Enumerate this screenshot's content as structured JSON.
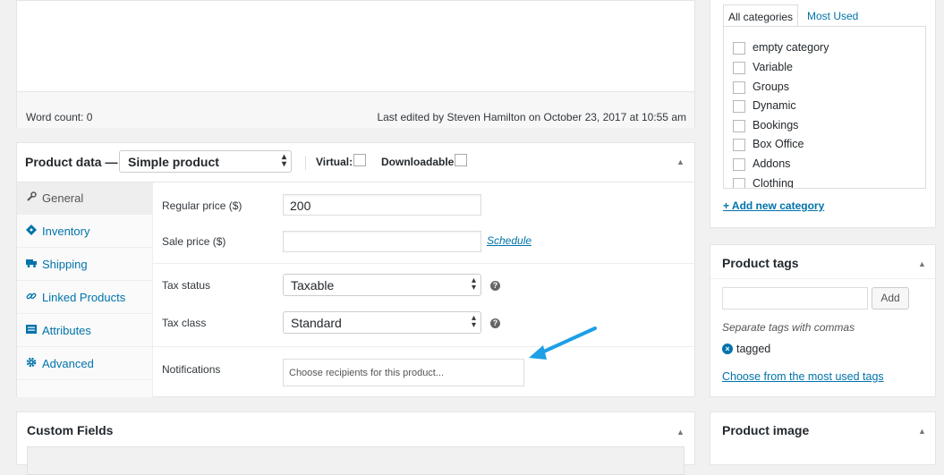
{
  "editor": {
    "word_count": "Word count: 0",
    "last_edited": "Last edited by Steven Hamilton on October 23, 2017 at 10:55 am"
  },
  "product_data": {
    "title": "Product data —",
    "type_select": "Simple product",
    "virtual_label": "Virtual:",
    "downloadable_label": "Downloadable:",
    "tabs": [
      {
        "label": "General",
        "icon": "wrench-icon"
      },
      {
        "label": "Inventory",
        "icon": "tag-icon"
      },
      {
        "label": "Shipping",
        "icon": "truck-icon"
      },
      {
        "label": "Linked Products",
        "icon": "link-icon"
      },
      {
        "label": "Attributes",
        "icon": "list-icon"
      },
      {
        "label": "Advanced",
        "icon": "gear-icon"
      }
    ],
    "fields": {
      "regular_price_label": "Regular price ($)",
      "regular_price_value": "200",
      "sale_price_label": "Sale price ($)",
      "sale_price_value": "",
      "schedule_link": "Schedule",
      "tax_status_label": "Tax status",
      "tax_status_value": "Taxable",
      "tax_class_label": "Tax class",
      "tax_class_value": "Standard",
      "notifications_label": "Notifications",
      "notifications_placeholder": "Choose recipients for this product..."
    }
  },
  "custom_fields": {
    "title": "Custom Fields"
  },
  "categories": {
    "tab_all": "All categories",
    "tab_most_used": "Most Used",
    "items": [
      "empty category",
      "Variable",
      "Groups",
      "Dynamic",
      "Bookings",
      "Box Office",
      "Addons",
      "Clothing"
    ],
    "add_new": "+ Add new category"
  },
  "tags": {
    "title": "Product tags",
    "add_button": "Add",
    "hint": "Separate tags with commas",
    "tag": "tagged",
    "choose_most_used": "Choose from the most used tags"
  },
  "product_image": {
    "title": "Product image"
  },
  "colors": {
    "link": "#0073aa",
    "arrow": "#1e9fe6"
  }
}
